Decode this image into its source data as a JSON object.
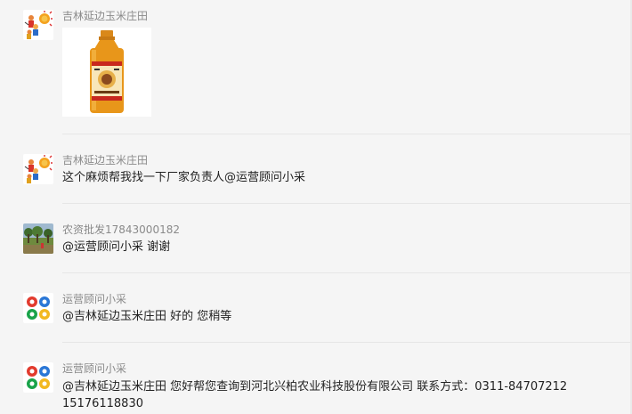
{
  "messages": [
    {
      "sender": "吉林延边玉米庄田",
      "avatar_icon": "sun-kids-avatar-icon",
      "image_icon": "pesticide-bottle-image-icon"
    },
    {
      "sender": "吉林延边玉米庄田",
      "avatar_icon": "sun-kids-avatar-icon",
      "text": "这个麻烦帮我找一下厂家负责人@运营顾问小采"
    },
    {
      "sender": "农资批发17843000182",
      "avatar_icon": "farm-field-avatar-icon",
      "text": "@运营顾问小采 谢谢"
    },
    {
      "sender": "运营顾问小采",
      "avatar_icon": "colorful-rings-avatar-icon",
      "text": "@吉林延边玉米庄田 好的 您稍等"
    },
    {
      "sender": "运营顾问小采",
      "avatar_icon": "colorful-rings-avatar-icon",
      "text": "@吉林延边玉米庄田 您好帮您查询到河北兴柏农业科技股份有限公司  联系方式：0311-84707212",
      "text2": "15176118830"
    }
  ],
  "colors": {
    "background": "#f5f5f5",
    "sender_text": "#8a8a8a",
    "message_text": "#222222",
    "divider": "#e6e6e6",
    "bottle_orange": "#e8961a"
  }
}
